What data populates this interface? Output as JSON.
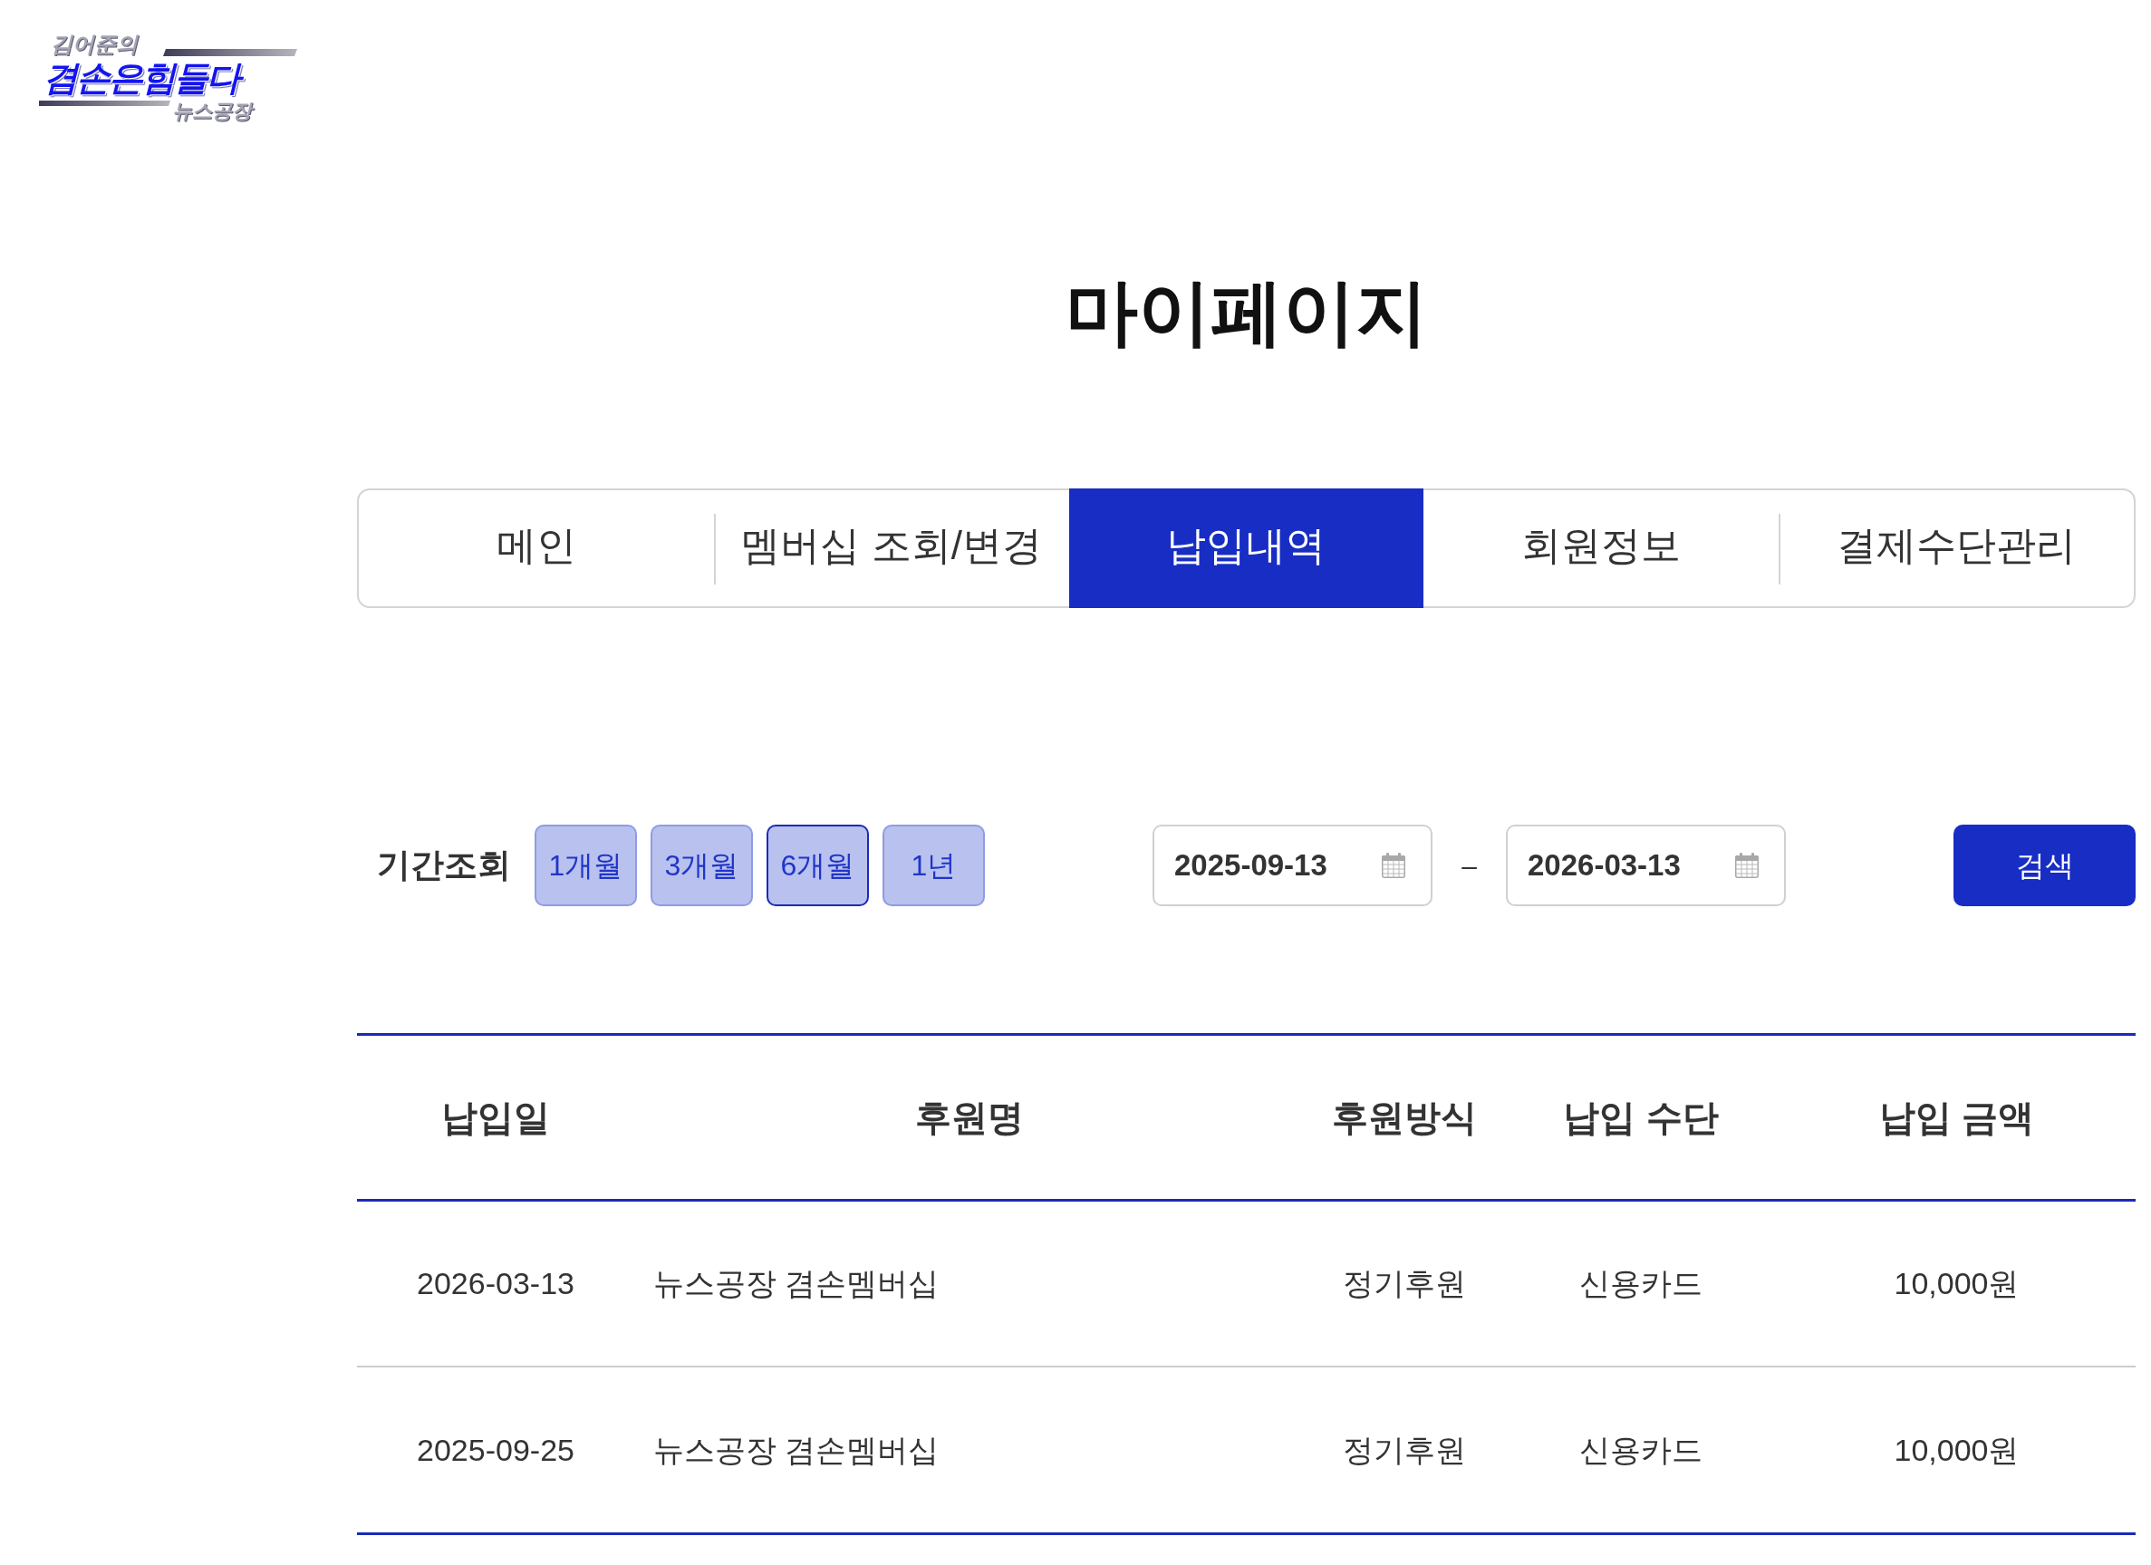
{
  "logo": {
    "subtitle": "김어준의",
    "title": "겸손은힘들다",
    "caption": "뉴스공장"
  },
  "page_title": "마이페이지",
  "tabs": [
    {
      "label": "메인",
      "selected": false
    },
    {
      "label": "멤버십 조회/변경",
      "selected": false
    },
    {
      "label": "납입내역",
      "selected": true
    },
    {
      "label": "회원정보",
      "selected": false
    },
    {
      "label": "결제수단관리",
      "selected": false
    }
  ],
  "period_filter": {
    "label": "기간조회",
    "options": [
      {
        "label": "1개월",
        "selected": false
      },
      {
        "label": "3개월",
        "selected": false
      },
      {
        "label": "6개월",
        "selected": true
      },
      {
        "label": "1년",
        "selected": false
      }
    ],
    "start_date": "2025-09-13",
    "separator": "–",
    "end_date": "2026-03-13",
    "search_button": "검색"
  },
  "table": {
    "columns": [
      "납입일",
      "후원명",
      "후원방식",
      "납입 수단",
      "납입 금액"
    ],
    "rows": [
      {
        "cells": [
          "2026-03-13",
          "뉴스공장 겸손멤버십",
          "정기후원",
          "신용카드",
          "10,000원"
        ]
      },
      {
        "cells": [
          "2025-09-25",
          "뉴스공장 겸손멤버십",
          "정기후원",
          "신용카드",
          "10,000원"
        ]
      }
    ]
  }
}
